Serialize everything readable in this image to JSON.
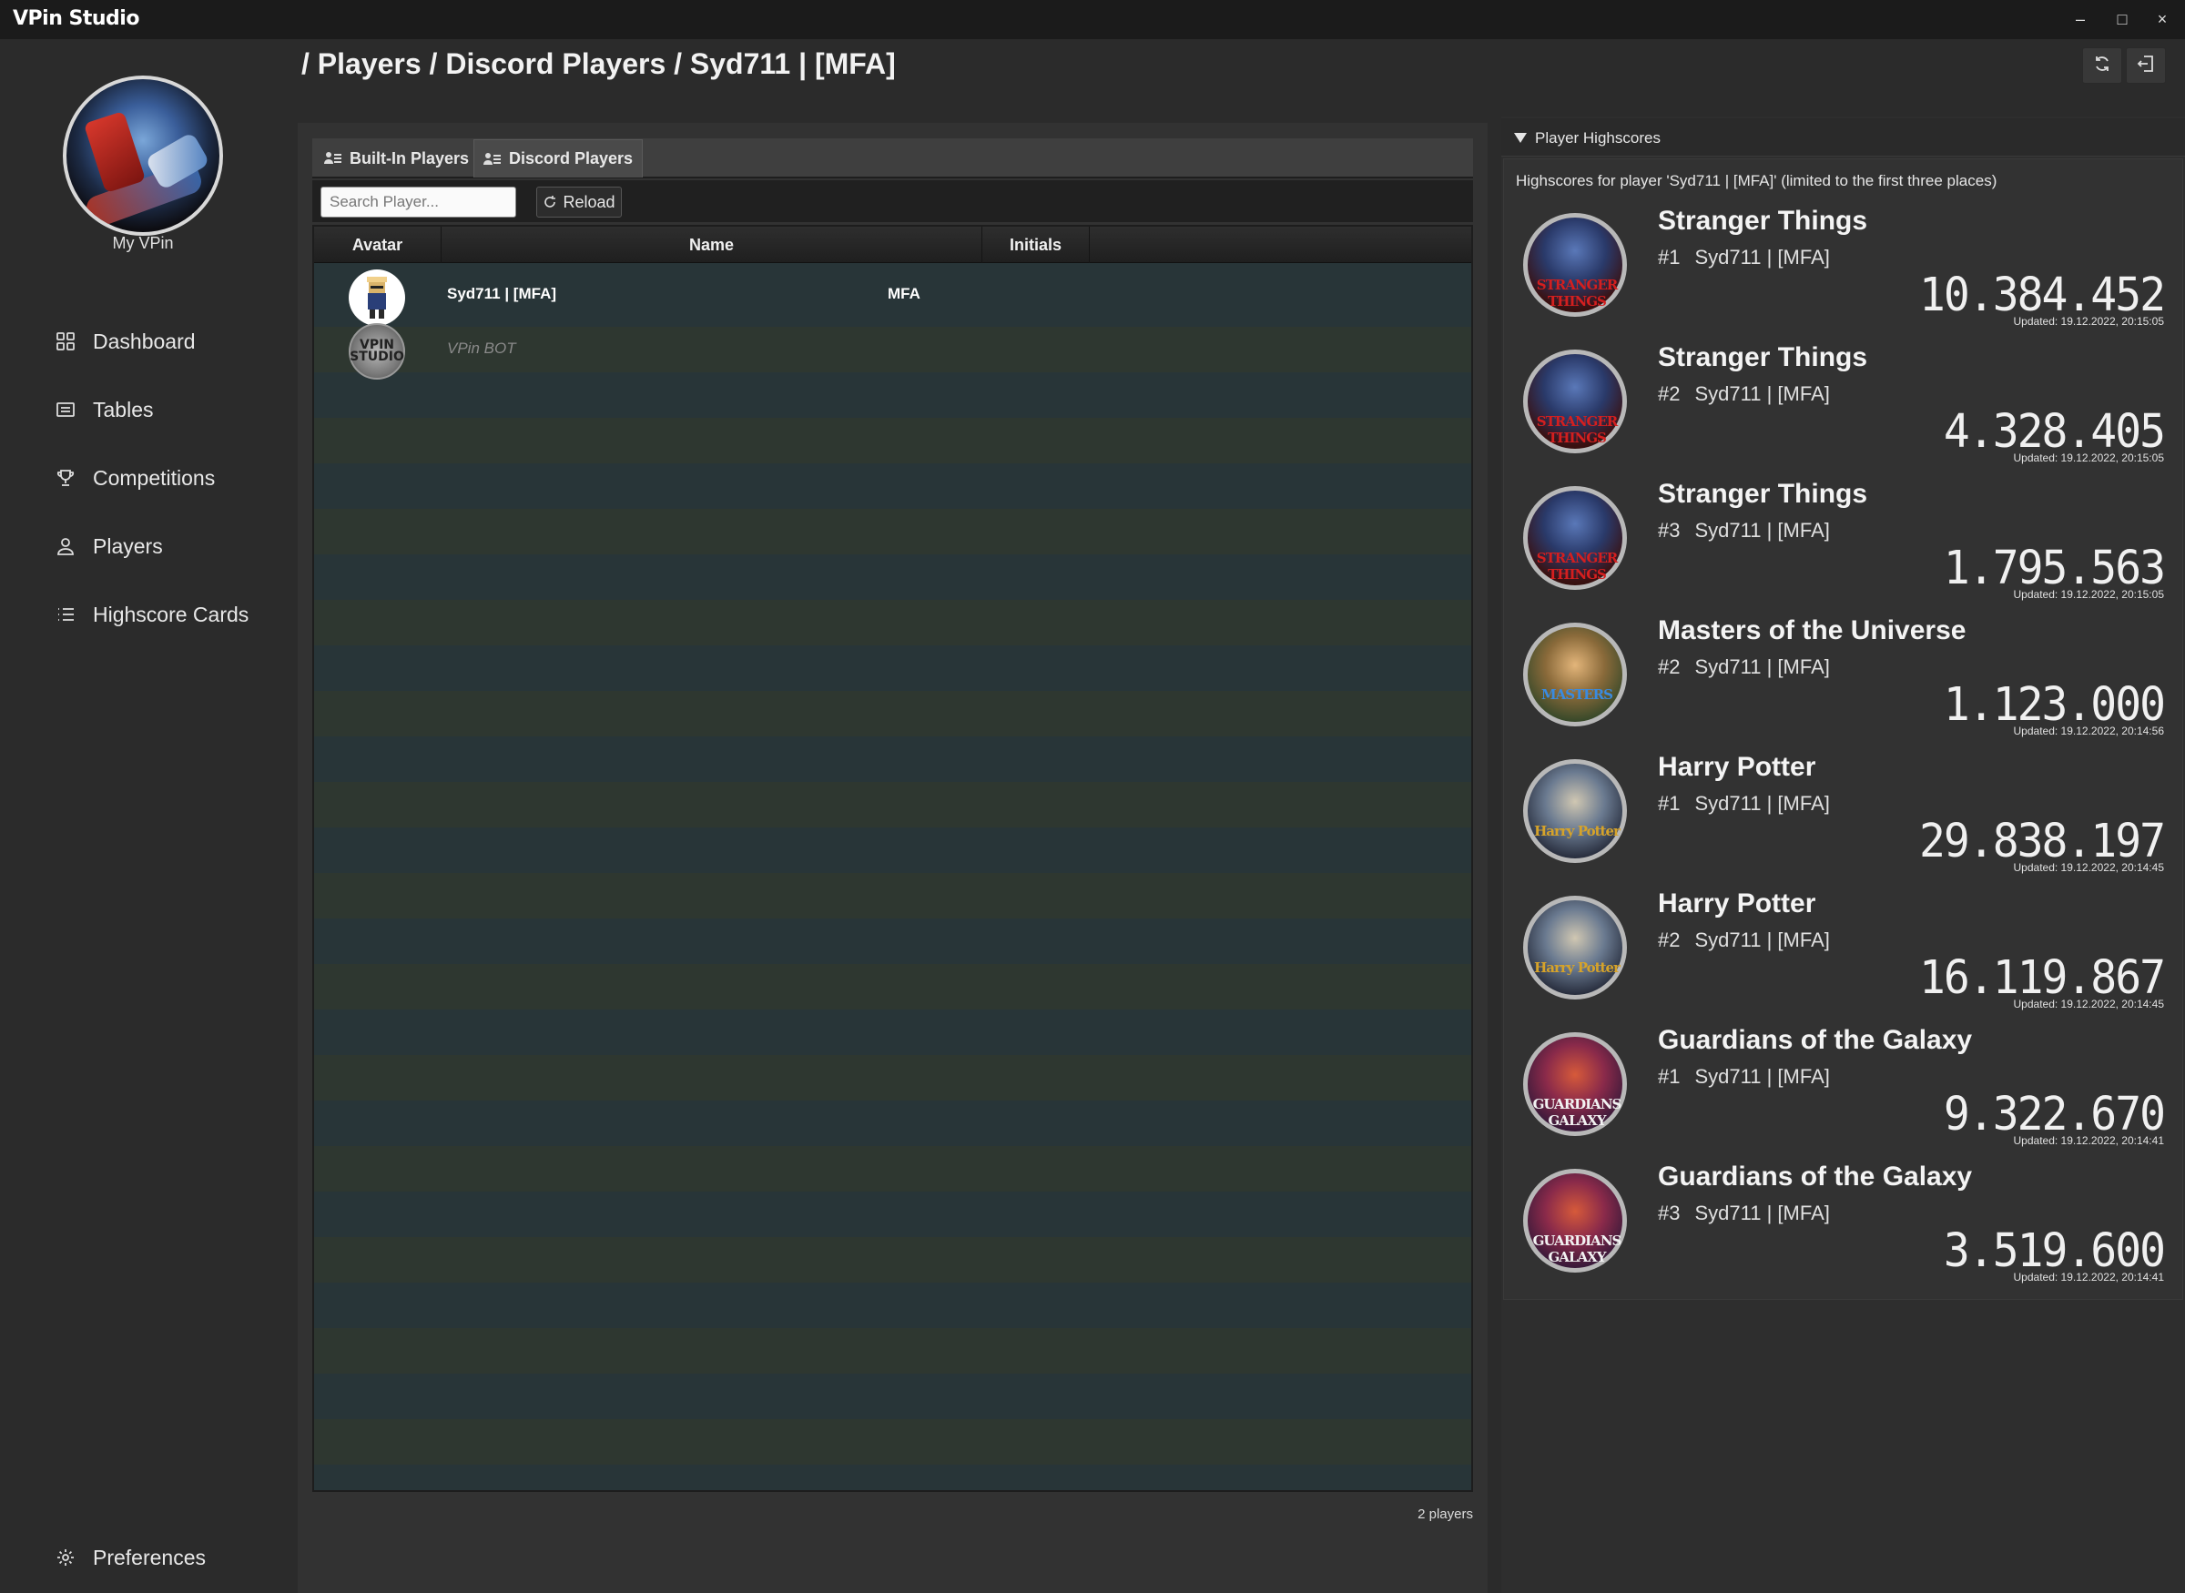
{
  "window": {
    "title": "VPin Studio",
    "minimize": "–",
    "maximize": "□",
    "close": "×"
  },
  "sidebar": {
    "label": "My VPin",
    "items": [
      {
        "label": "Dashboard",
        "icon": "dashboard-icon"
      },
      {
        "label": "Tables",
        "icon": "tables-icon"
      },
      {
        "label": "Competitions",
        "icon": "trophy-icon"
      },
      {
        "label": "Players",
        "icon": "user-icon"
      },
      {
        "label": "Highscore Cards",
        "icon": "list-icon"
      }
    ],
    "preferences": "Preferences"
  },
  "header": {
    "breadcrumb": "/ Players / Discord Players / Syd711 | [MFA]"
  },
  "tabs": [
    {
      "label": "Built-In Players",
      "active": false
    },
    {
      "label": "Discord Players",
      "active": true
    }
  ],
  "toolbar": {
    "search_placeholder": "Search Player...",
    "reload_label": "Reload"
  },
  "table": {
    "columns": [
      "Avatar",
      "Name",
      "Initials"
    ],
    "rows": [
      {
        "name": "Syd711 | [MFA]",
        "initials": "MFA"
      },
      {
        "name": "VPin BOT",
        "initials": ""
      }
    ],
    "footer": "2 players"
  },
  "highscores": {
    "section_title": "Player Highscores",
    "description": "Highscores for player 'Syd711 | [MFA]' (limited to the first three places)",
    "entries": [
      {
        "table": "Stranger Things",
        "position": "#1",
        "player": "Syd711 | [MFA]",
        "score": "10.384.452",
        "updated": "Updated: 19.12.2022, 20:15:05",
        "wheel": "STRANGER THINGS"
      },
      {
        "table": "Stranger Things",
        "position": "#2",
        "player": "Syd711 | [MFA]",
        "score": "4.328.405",
        "updated": "Updated: 19.12.2022, 20:15:05",
        "wheel": "STRANGER THINGS"
      },
      {
        "table": "Stranger Things",
        "position": "#3",
        "player": "Syd711 | [MFA]",
        "score": "1.795.563",
        "updated": "Updated: 19.12.2022, 20:15:05",
        "wheel": "STRANGER THINGS"
      },
      {
        "table": "Masters of the Universe",
        "position": "#2",
        "player": "Syd711 | [MFA]",
        "score": "1.123.000",
        "updated": "Updated: 19.12.2022, 20:14:56",
        "wheel": "MASTERS"
      },
      {
        "table": "Harry Potter",
        "position": "#1",
        "player": "Syd711 | [MFA]",
        "score": "29.838.197",
        "updated": "Updated: 19.12.2022, 20:14:45",
        "wheel": "Harry Potter"
      },
      {
        "table": "Harry Potter",
        "position": "#2",
        "player": "Syd711 | [MFA]",
        "score": "16.119.867",
        "updated": "Updated: 19.12.2022, 20:14:45",
        "wheel": "Harry Potter"
      },
      {
        "table": "Guardians of the Galaxy",
        "position": "#1",
        "player": "Syd711 | [MFA]",
        "score": "9.322.670",
        "updated": "Updated: 19.12.2022, 20:14:41",
        "wheel": "GUARDIANS GALAXY"
      },
      {
        "table": "Guardians of the Galaxy",
        "position": "#3",
        "player": "Syd711 | [MFA]",
        "score": "3.519.600",
        "updated": "Updated: 19.12.2022, 20:14:41",
        "wheel": "GUARDIANS GALAXY"
      }
    ]
  },
  "colors": {
    "background": "#2b2b2b",
    "titlebar": "#1b1b1b",
    "row_even": "#283538",
    "row_odd": "#2e3730",
    "stranger_red": "#c81e1e"
  }
}
